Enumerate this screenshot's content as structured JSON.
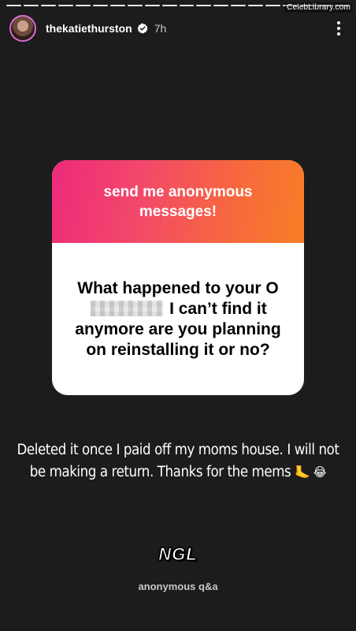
{
  "watermark": "CelebLibrary.com",
  "header": {
    "username": "thekatiethurston",
    "time_ago": "7h"
  },
  "sticker": {
    "prompt": "send me anonymous messages!",
    "question_before": "What happened to your O",
    "question_after": " I can’t find it anymore are you planning on reinstalling it or no?"
  },
  "answer": {
    "text": "Deleted it once I paid off my moms house. I will not be making a return. Thanks for the mems",
    "emojis": "🦶 😂"
  },
  "app": {
    "logo": "NGL",
    "subtitle": "anonymous q&a"
  },
  "icons": {
    "verified": "verified-badge-icon",
    "more": "more-vertical-icon"
  },
  "colors": {
    "gradient_start": "#ee2a7b",
    "gradient_end": "#f97f26",
    "background": "#1c1c1c"
  }
}
